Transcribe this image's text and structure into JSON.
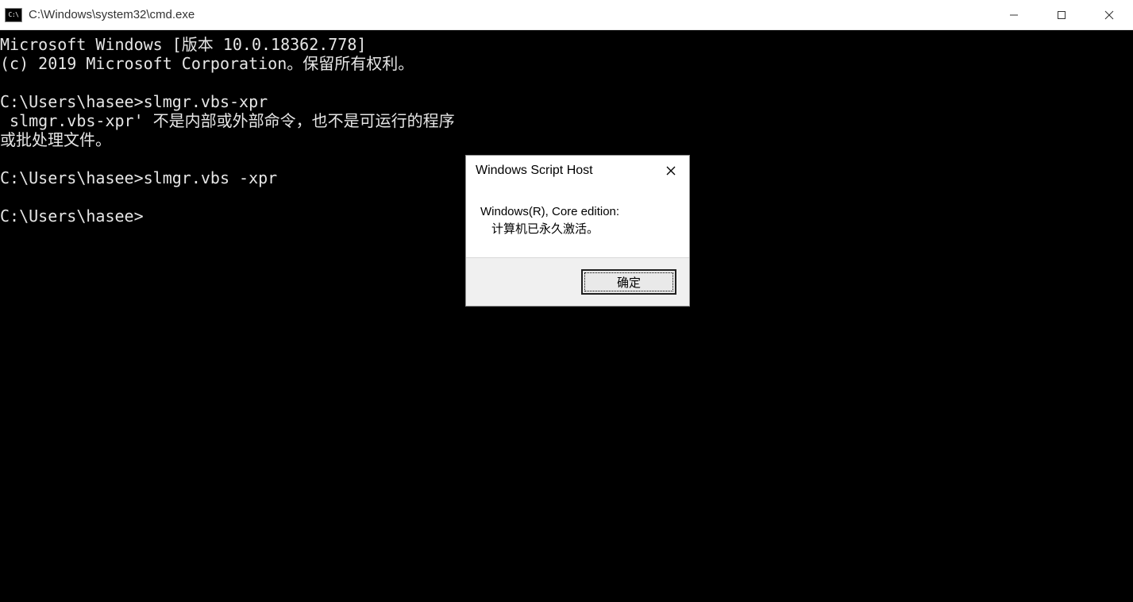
{
  "window": {
    "title": "C:\\Windows\\system32\\cmd.exe"
  },
  "terminal_lines": [
    "Microsoft Windows [版本 10.0.18362.778]",
    "(c) 2019 Microsoft Corporation。保留所有权利。",
    "",
    "C:\\Users\\hasee>slmgr.vbs-xpr",
    " slmgr.vbs-xpr' 不是内部或外部命令，也不是可运行的程序",
    "或批处理文件。",
    "",
    "C:\\Users\\hasee>slmgr.vbs -xpr",
    "",
    "C:\\Users\\hasee>"
  ],
  "dialog": {
    "title": "Windows Script Host",
    "message_line1": "Windows(R), Core edition:",
    "message_line2": "计算机已永久激活。",
    "ok_label": "确定"
  }
}
